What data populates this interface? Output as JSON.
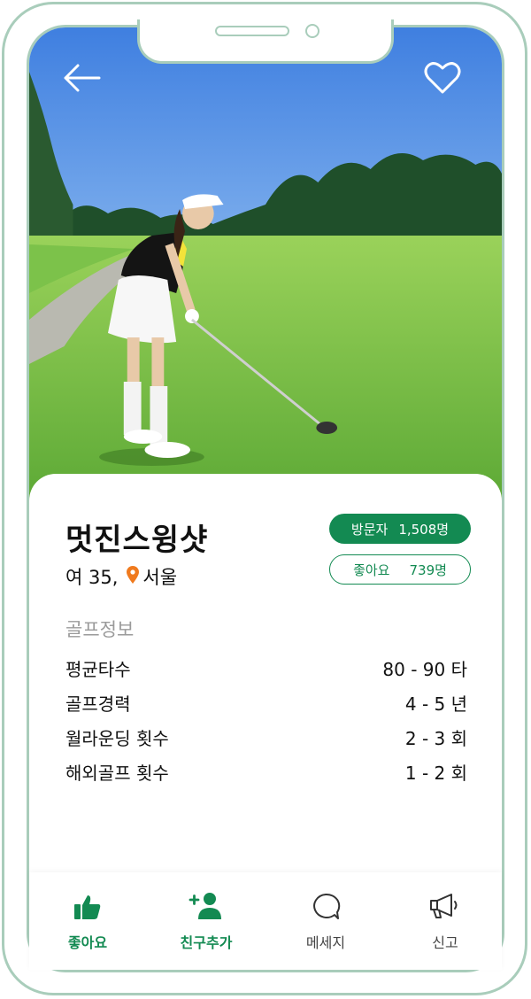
{
  "profile": {
    "name": "멋진스윙샷",
    "gender_age": "여 35,",
    "location": "서울"
  },
  "stats": {
    "visitors_label": "방문자",
    "visitors_value": "1,508명",
    "likes_label": "좋아요",
    "likes_value": "739명"
  },
  "golf_info": {
    "title": "골프정보",
    "rows": [
      {
        "label": "평균타수",
        "value": "80 - 90 타"
      },
      {
        "label": "골프경력",
        "value": "4 - 5 년"
      },
      {
        "label": "월라운딩 횟수",
        "value": "2 - 3 회"
      },
      {
        "label": "해외골프 횟수",
        "value": "1 - 2 회"
      }
    ]
  },
  "tabbar": {
    "like": "좋아요",
    "add_friend": "친구추가",
    "message": "메세지",
    "report": "신고"
  },
  "icons": {
    "back": "arrow-left-icon",
    "favorite": "heart-icon",
    "location": "map-pin-icon",
    "like": "thumbs-up-icon",
    "add_friend": "add-user-icon",
    "message": "chat-bubble-icon",
    "report": "megaphone-icon"
  },
  "colors": {
    "accent": "#138a52",
    "frame": "#a9cdbb",
    "pin": "#f07a1e"
  }
}
